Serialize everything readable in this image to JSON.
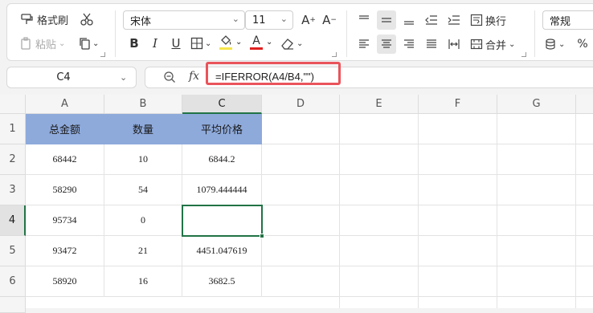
{
  "ribbon": {
    "format_painter": "格式刷",
    "paste": "粘贴",
    "font_name": "宋体",
    "font_size": "11",
    "wrap_text": "换行",
    "merge": "合并",
    "number_format": "常规",
    "percent": "%",
    "bold": "B",
    "italic": "I",
    "underline": "U",
    "font_color_letter": "A",
    "font_color": "#e02020"
  },
  "formula_bar": {
    "name_box": "C4",
    "fx_label": "fx",
    "formula": "=IFERROR(A4/B4,\"\")"
  },
  "columns": [
    "A",
    "B",
    "C",
    "D",
    "E",
    "F",
    "G"
  ],
  "rows": [
    "1",
    "2",
    "3",
    "4",
    "5",
    "6"
  ],
  "header_cells": [
    "总金额",
    "数量",
    "平均价格"
  ],
  "data": [
    [
      "68442",
      "10",
      "6844.2"
    ],
    [
      "58290",
      "54",
      "1079.444444"
    ],
    [
      "95734",
      "0",
      ""
    ],
    [
      "93472",
      "21",
      "4451.047619"
    ],
    [
      "58920",
      "16",
      "3682.5"
    ]
  ],
  "colors": {
    "header_fill": "#8eaadb",
    "selection": "#217346",
    "highlight_border": "#e9545a"
  }
}
